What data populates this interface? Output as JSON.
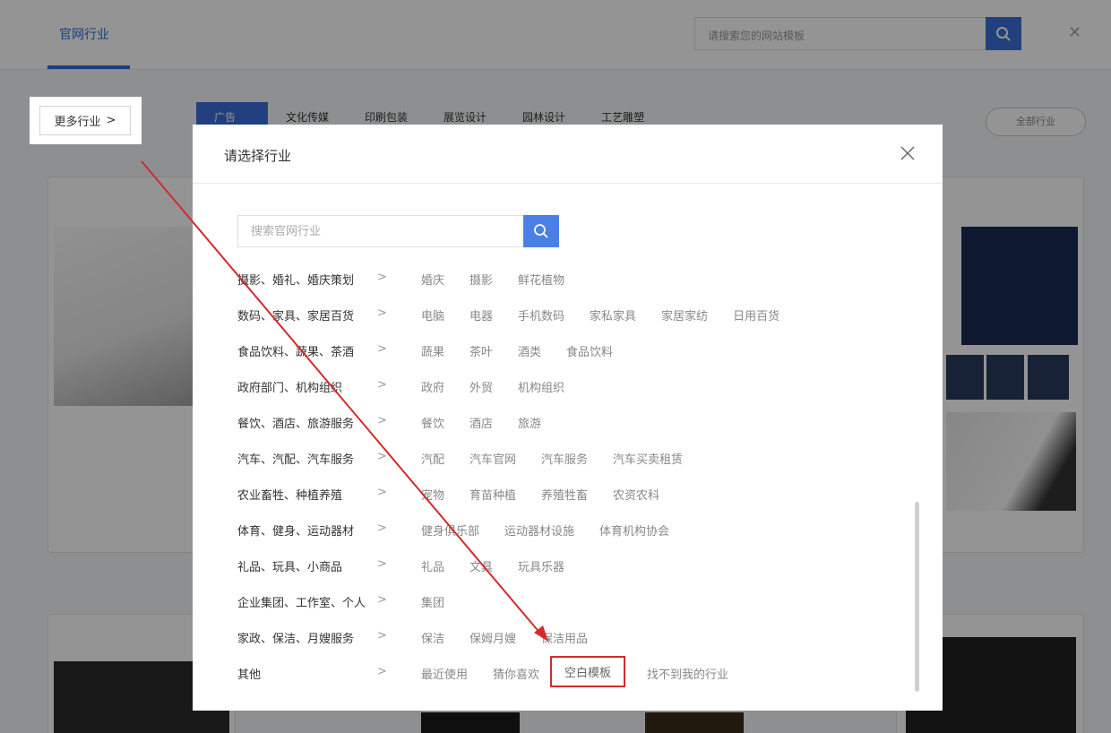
{
  "background": {
    "top_tab": "官网行业",
    "search_placeholder": "请搜索您的网站模板",
    "categories": [
      "广告",
      "文化传媒",
      "印刷包装",
      "展览设计",
      "园林设计",
      "工艺雕塑"
    ],
    "right_button": "全部行业"
  },
  "more_button": {
    "label": "更多行业",
    "chevron": ">"
  },
  "modal": {
    "title": "请选择行业",
    "search_placeholder": "搜索官网行业",
    "rows": [
      {
        "label": "摄影、婚礼、婚庆策划",
        "tags": [
          "婚庆",
          "摄影",
          "鲜花植物"
        ]
      },
      {
        "label": "数码、家具、家居百货",
        "tags": [
          "电脑",
          "电器",
          "手机数码",
          "家私家具",
          "家居家纺",
          "日用百货"
        ]
      },
      {
        "label": "食品饮料、蔬果、茶酒",
        "tags": [
          "蔬果",
          "茶叶",
          "酒类",
          "食品饮料"
        ]
      },
      {
        "label": "政府部门、机构组织",
        "tags": [
          "政府",
          "外贸",
          "机构组织"
        ]
      },
      {
        "label": "餐饮、酒店、旅游服务",
        "tags": [
          "餐饮",
          "酒店",
          "旅游"
        ]
      },
      {
        "label": "汽车、汽配、汽车服务",
        "tags": [
          "汽配",
          "汽车官网",
          "汽车服务",
          "汽车买卖租赁"
        ]
      },
      {
        "label": "农业畜牲、种植养殖",
        "tags": [
          "宠物",
          "育苗种植",
          "养殖牲畜",
          "农资农科"
        ]
      },
      {
        "label": "体育、健身、运动器材",
        "tags": [
          "健身俱乐部",
          "运动器材设施",
          "体育机构协会"
        ]
      },
      {
        "label": "礼品、玩具、小商品",
        "tags": [
          "礼品",
          "文具",
          "玩具乐器"
        ]
      },
      {
        "label": "企业集团、工作室、个人",
        "tags": [
          "集团"
        ]
      },
      {
        "label": "家政、保洁、月嫂服务",
        "tags": [
          "保洁",
          "保姆月嫂",
          "保洁用品"
        ]
      },
      {
        "label": "其他",
        "tags": [
          "最近使用",
          "猜你喜欢",
          "空白模板",
          "找不到我的行业"
        ],
        "highlighted_tag": "空白模板"
      }
    ],
    "row_chevron": ">"
  },
  "colors": {
    "accent": "#4a7fe6",
    "annotation": "#d32b2b"
  },
  "icons": {
    "close": "close-icon",
    "search": "search-icon",
    "chevron": "chevron-right-icon"
  }
}
